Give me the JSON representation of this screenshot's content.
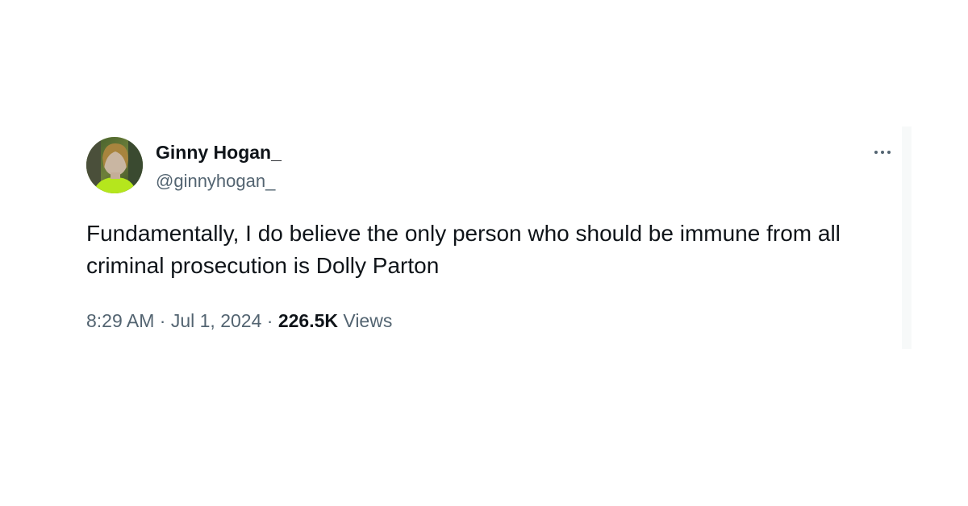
{
  "author": {
    "display_name": "Ginny Hogan_",
    "handle": "@ginnyhogan_",
    "avatar_icon": "avatar-photo"
  },
  "tweet": {
    "text": "Fundamentally, I do believe the only person who should be immune from all criminal prosecution is Dolly Parton",
    "time": "8:29 AM",
    "separator": " · ",
    "date": "Jul 1, 2024",
    "views_count": "226.5K",
    "views_label": " Views"
  },
  "actions": {
    "more_icon": "more-horizontal-icon"
  },
  "colors": {
    "text_primary": "#0f1419",
    "text_secondary": "#536471",
    "background": "#ffffff",
    "avatar_accent": "#b5e61d"
  }
}
